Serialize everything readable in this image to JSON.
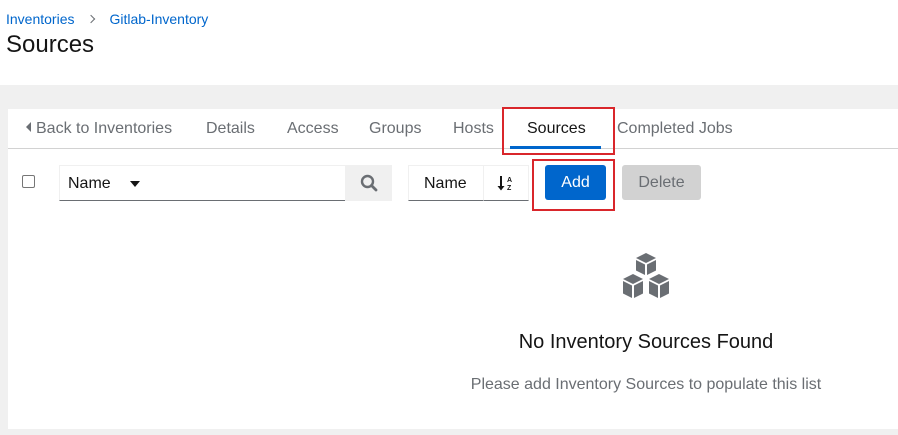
{
  "breadcrumb": {
    "root": "Inventories",
    "current": "Gitlab-Inventory"
  },
  "page": {
    "title": "Sources"
  },
  "tabs": [
    {
      "label": "Back to Inventories"
    },
    {
      "label": "Details"
    },
    {
      "label": "Access"
    },
    {
      "label": "Groups"
    },
    {
      "label": "Hosts"
    },
    {
      "label": "Sources"
    },
    {
      "label": "Completed Jobs"
    }
  ],
  "toolbar": {
    "filter_field": "Name",
    "search_value": "",
    "sort_field": "Name",
    "add_label": "Add",
    "delete_label": "Delete"
  },
  "empty_state": {
    "title": "No Inventory Sources Found",
    "body": "Please add Inventory Sources to populate this list"
  },
  "colors": {
    "accent": "#0066cc",
    "highlight": "#d9262b"
  }
}
